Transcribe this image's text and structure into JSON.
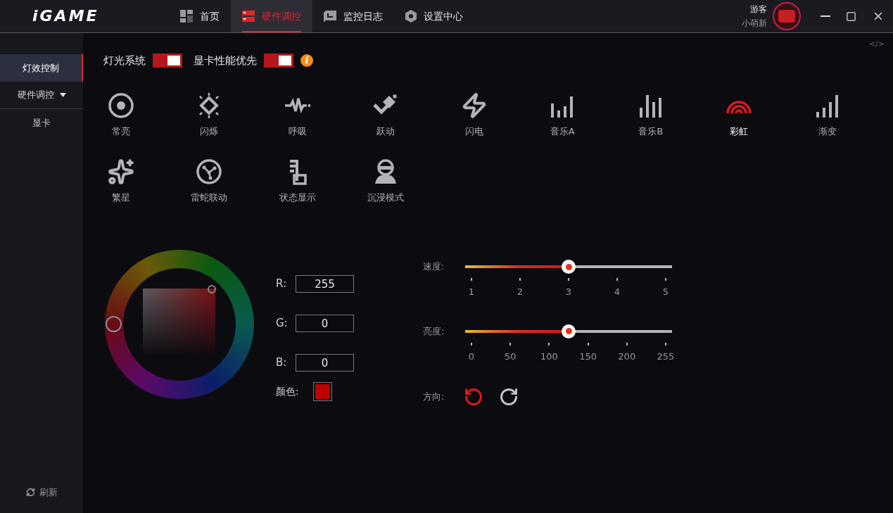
{
  "header": {
    "logo": "iGAME",
    "nav": [
      {
        "label": "首页",
        "selected": false,
        "kind": "home"
      },
      {
        "label": "硬件调控",
        "selected": true,
        "kind": "hardware"
      },
      {
        "label": "监控日志",
        "selected": false,
        "kind": "log"
      },
      {
        "label": "设置中心",
        "selected": false,
        "kind": "settings"
      }
    ],
    "user": {
      "name": "游客",
      "level": "小萌新"
    }
  },
  "sidebar": {
    "items": [
      {
        "label": "灯效控制",
        "selected": true
      },
      {
        "label": "硬件调控",
        "selected": false,
        "expanded": true,
        "children": [
          {
            "label": "显卡",
            "selected": false
          }
        ]
      }
    ],
    "refresh": "刷新"
  },
  "main": {
    "code_toggle": "</>",
    "switches": [
      {
        "label": "灯光系统",
        "on": true
      },
      {
        "label": "显卡性能优先",
        "on": true,
        "info": "i"
      }
    ],
    "effects": [
      {
        "label": "常亮",
        "kind": "steady",
        "selected": false
      },
      {
        "label": "闪烁",
        "kind": "flash",
        "selected": false
      },
      {
        "label": "呼吸",
        "kind": "breath",
        "selected": false
      },
      {
        "label": "跃动",
        "kind": "jump",
        "selected": false
      },
      {
        "label": "闪电",
        "kind": "lightning",
        "selected": false
      },
      {
        "label": "音乐A",
        "kind": "musica",
        "selected": false
      },
      {
        "label": "音乐B",
        "kind": "musicb",
        "selected": false
      },
      {
        "label": "彩虹",
        "kind": "rainbow",
        "selected": true
      },
      {
        "label": "渐变",
        "kind": "gradient",
        "selected": false
      },
      {
        "label": "繁星",
        "kind": "stars",
        "selected": false
      },
      {
        "label": "雷蛇联动",
        "kind": "razer",
        "selected": false
      },
      {
        "label": "状态显示",
        "kind": "status",
        "selected": false
      },
      {
        "label": "沉浸模式",
        "kind": "immersive",
        "selected": false
      }
    ],
    "rgb": [
      {
        "label": "R:",
        "value": "255"
      },
      {
        "label": "G:",
        "value": "0"
      },
      {
        "label": "B:",
        "value": "0"
      }
    ],
    "swatch": {
      "label": "颜色:",
      "color": "#bf0000"
    },
    "sliders": [
      {
        "label": "速度:",
        "level": 0.5,
        "ticks": [
          "1",
          "2",
          "3",
          "4",
          "5"
        ]
      },
      {
        "label": "亮度:",
        "level": 0.5,
        "ticks": [
          "0",
          "50",
          "100",
          "150",
          "200",
          "255"
        ]
      }
    ],
    "direction": {
      "label": "方向:",
      "buttons": [
        {
          "kind": "ccw",
          "selected": true
        },
        {
          "kind": "cw",
          "selected": false
        }
      ]
    }
  }
}
